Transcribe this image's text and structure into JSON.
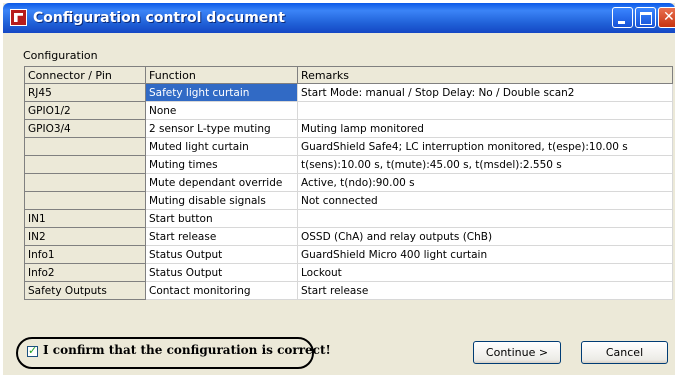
{
  "window": {
    "title": "Configuration control document"
  },
  "group_label": "Configuration",
  "table": {
    "headers": [
      "Connector / Pin",
      "Function",
      "Remarks"
    ],
    "rows": [
      {
        "pin": "RJ45",
        "function": "Safety light curtain",
        "remarks": "Start Mode: manual / Stop Delay: No / Double scan2",
        "selected": true
      },
      {
        "pin": "GPIO1/2",
        "function": "None",
        "remarks": ""
      },
      {
        "pin": "GPIO3/4",
        "function": "2 sensor L-type muting",
        "remarks": "Muting lamp monitored"
      },
      {
        "pin": "",
        "function": "Muted light curtain",
        "remarks": "GuardShield Safe4; LC interruption monitored, t(espe):10.00 s"
      },
      {
        "pin": "",
        "function": "Muting times",
        "remarks": "t(sens):10.00 s, t(mute):45.00 s, t(msdel):2.550 s"
      },
      {
        "pin": "",
        "function": "Mute dependant override",
        "remarks": "Active, t(ndo):90.00 s"
      },
      {
        "pin": "",
        "function": "Muting disable signals",
        "remarks": "Not connected"
      },
      {
        "pin": "IN1",
        "function": "Start button",
        "remarks": ""
      },
      {
        "pin": "IN2",
        "function": "Start release",
        "remarks": "OSSD (ChA) and relay outputs (ChB)"
      },
      {
        "pin": "Info1",
        "function": "Status Output",
        "remarks": "GuardShield Micro 400 light curtain"
      },
      {
        "pin": "Info2",
        "function": "Status Output",
        "remarks": "Lockout"
      },
      {
        "pin": "Safety Outputs",
        "function": "Contact monitoring",
        "remarks": "Start release"
      }
    ]
  },
  "confirm": {
    "label": "I confirm that the configuration is correct!",
    "checked": true
  },
  "buttons": {
    "continue": "Continue >",
    "cancel": "Cancel"
  },
  "colors": {
    "titlebar": "#0a58e8",
    "selection": "#316ac5",
    "dialog_bg": "#ece9d8"
  }
}
